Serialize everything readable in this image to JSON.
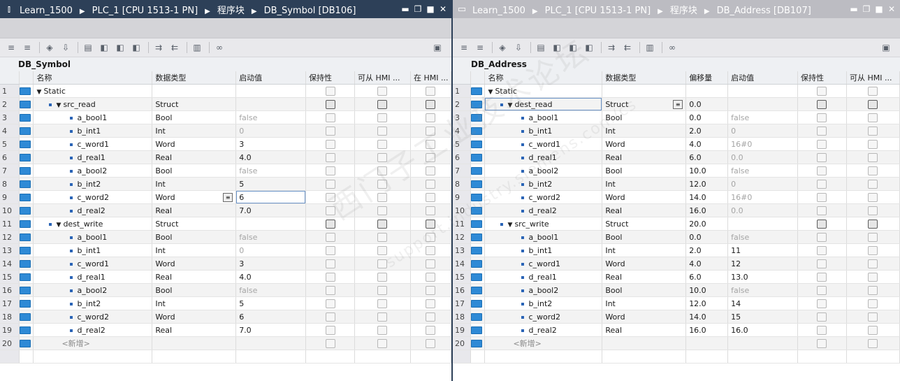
{
  "left": {
    "title_icon": "pin-icon",
    "breadcrumbs": [
      "Learn_1500",
      "PLC_1 [CPU 1513-1 PN]",
      "程序块",
      "DB_Symbol [DB106]"
    ],
    "db_name": "DB_Symbol",
    "headers": [
      "名称",
      "数据类型",
      "启动值",
      "保持性",
      "可从 HMI ...",
      "在 HMI ..."
    ],
    "rows": [
      {
        "num": "1",
        "level": 0,
        "expand": true,
        "name": "Static",
        "type": "",
        "start": "",
        "muted": false
      },
      {
        "num": "2",
        "level": 1,
        "expand": true,
        "name": "src_read",
        "type": "Struct",
        "start": "",
        "muted": false
      },
      {
        "num": "3",
        "level": 2,
        "name": "a_bool1",
        "type": "Bool",
        "start": "false",
        "muted": true
      },
      {
        "num": "4",
        "level": 2,
        "name": "b_int1",
        "type": "Int",
        "start": "0",
        "muted": true
      },
      {
        "num": "5",
        "level": 2,
        "name": "c_word1",
        "type": "Word",
        "start": "3",
        "muted": false
      },
      {
        "num": "6",
        "level": 2,
        "name": "d_real1",
        "type": "Real",
        "start": "4.0",
        "muted": false
      },
      {
        "num": "7",
        "level": 2,
        "name": "a_bool2",
        "type": "Bool",
        "start": "false",
        "muted": true
      },
      {
        "num": "8",
        "level": 2,
        "name": "b_int2",
        "type": "Int",
        "start": "5",
        "muted": false
      },
      {
        "num": "9",
        "level": 2,
        "name": "c_word2",
        "type": "Word",
        "start": "6",
        "muted": false,
        "editing": true
      },
      {
        "num": "10",
        "level": 2,
        "name": "d_real2",
        "type": "Real",
        "start": "7.0",
        "muted": false
      },
      {
        "num": "11",
        "level": 1,
        "expand": true,
        "name": "dest_write",
        "type": "Struct",
        "start": "",
        "muted": false
      },
      {
        "num": "12",
        "level": 2,
        "name": "a_bool1",
        "type": "Bool",
        "start": "false",
        "muted": true
      },
      {
        "num": "13",
        "level": 2,
        "name": "b_int1",
        "type": "Int",
        "start": "0",
        "muted": true
      },
      {
        "num": "14",
        "level": 2,
        "name": "c_word1",
        "type": "Word",
        "start": "3",
        "muted": false
      },
      {
        "num": "15",
        "level": 2,
        "name": "d_real1",
        "type": "Real",
        "start": "4.0",
        "muted": false
      },
      {
        "num": "16",
        "level": 2,
        "name": "a_bool2",
        "type": "Bool",
        "start": "false",
        "muted": true
      },
      {
        "num": "17",
        "level": 2,
        "name": "b_int2",
        "type": "Int",
        "start": "5",
        "muted": false
      },
      {
        "num": "18",
        "level": 2,
        "name": "c_word2",
        "type": "Word",
        "start": "6",
        "muted": false
      },
      {
        "num": "19",
        "level": 2,
        "name": "d_real2",
        "type": "Real",
        "start": "7.0",
        "muted": false
      },
      {
        "num": "20",
        "level": 1,
        "new": true,
        "name": "<新增>",
        "type": "",
        "start": "",
        "muted": true
      }
    ]
  },
  "right": {
    "title_icon": "window-icon",
    "breadcrumbs": [
      "Learn_1500",
      "PLC_1 [CPU 1513-1 PN]",
      "程序块",
      "DB_Address [DB107]"
    ],
    "db_name": "DB_Address",
    "headers": [
      "名称",
      "数据类型",
      "偏移量",
      "启动值",
      "保持性",
      "可从 HMI ..."
    ],
    "rows": [
      {
        "num": "1",
        "level": 0,
        "expand": true,
        "name": "Static",
        "type": "",
        "offset": "",
        "start": "",
        "muted": false
      },
      {
        "num": "2",
        "level": 1,
        "expand": true,
        "name": "dest_read",
        "type": "Struct",
        "offset": "0.0",
        "start": "",
        "muted": false,
        "selected": true
      },
      {
        "num": "3",
        "level": 2,
        "name": "a_bool1",
        "type": "Bool",
        "offset": "0.0",
        "start": "false",
        "muted": true
      },
      {
        "num": "4",
        "level": 2,
        "name": "b_int1",
        "type": "Int",
        "offset": "2.0",
        "start": "0",
        "muted": true
      },
      {
        "num": "5",
        "level": 2,
        "name": "c_word1",
        "type": "Word",
        "offset": "4.0",
        "start": "16#0",
        "muted": true
      },
      {
        "num": "6",
        "level": 2,
        "name": "d_real1",
        "type": "Real",
        "offset": "6.0",
        "start": "0.0",
        "muted": true
      },
      {
        "num": "7",
        "level": 2,
        "name": "a_bool2",
        "type": "Bool",
        "offset": "10.0",
        "start": "false",
        "muted": true
      },
      {
        "num": "8",
        "level": 2,
        "name": "b_int2",
        "type": "Int",
        "offset": "12.0",
        "start": "0",
        "muted": true
      },
      {
        "num": "9",
        "level": 2,
        "name": "c_word2",
        "type": "Word",
        "offset": "14.0",
        "start": "16#0",
        "muted": true
      },
      {
        "num": "10",
        "level": 2,
        "name": "d_real2",
        "type": "Real",
        "offset": "16.0",
        "start": "0.0",
        "muted": true
      },
      {
        "num": "11",
        "level": 1,
        "expand": true,
        "name": "src_write",
        "type": "Struct",
        "offset": "20.0",
        "start": "",
        "muted": false
      },
      {
        "num": "12",
        "level": 2,
        "name": "a_bool1",
        "type": "Bool",
        "offset": "0.0",
        "start": "false",
        "muted": true
      },
      {
        "num": "13",
        "level": 2,
        "name": "b_int1",
        "type": "Int",
        "offset": "2.0",
        "start": "11",
        "muted": false
      },
      {
        "num": "14",
        "level": 2,
        "name": "c_word1",
        "type": "Word",
        "offset": "4.0",
        "start": "12",
        "muted": false
      },
      {
        "num": "15",
        "level": 2,
        "name": "d_real1",
        "type": "Real",
        "offset": "6.0",
        "start": "13.0",
        "muted": false
      },
      {
        "num": "16",
        "level": 2,
        "name": "a_bool2",
        "type": "Bool",
        "offset": "10.0",
        "start": "false",
        "muted": true
      },
      {
        "num": "17",
        "level": 2,
        "name": "b_int2",
        "type": "Int",
        "offset": "12.0",
        "start": "14",
        "muted": false
      },
      {
        "num": "18",
        "level": 2,
        "name": "c_word2",
        "type": "Word",
        "offset": "14.0",
        "start": "15",
        "muted": false
      },
      {
        "num": "19",
        "level": 2,
        "name": "d_real2",
        "type": "Real",
        "offset": "16.0",
        "start": "16.0",
        "muted": false
      },
      {
        "num": "20",
        "level": 1,
        "new": true,
        "name": "<新增>",
        "type": "",
        "offset": "",
        "start": "",
        "muted": true
      }
    ]
  },
  "toolbar_icons": [
    "insert-row-icon",
    "add-row-icon",
    "monitor-icon",
    "snapshot-icon",
    "copy-snapshot-icon",
    "load-start-icon",
    "load-snapshot-icon",
    "reset-start-icon",
    "expand-icon",
    "collapse-icon",
    "keep-actual-icon",
    "settings-glasses-icon"
  ],
  "watermark": {
    "text": "西门子工业技术论坛",
    "sub": "support.industry.siemens.com/cs"
  },
  "colors": {
    "active_title": "#2d4058",
    "inactive_title": "#bcbcc2",
    "io_icon": "#2e8ad6"
  }
}
